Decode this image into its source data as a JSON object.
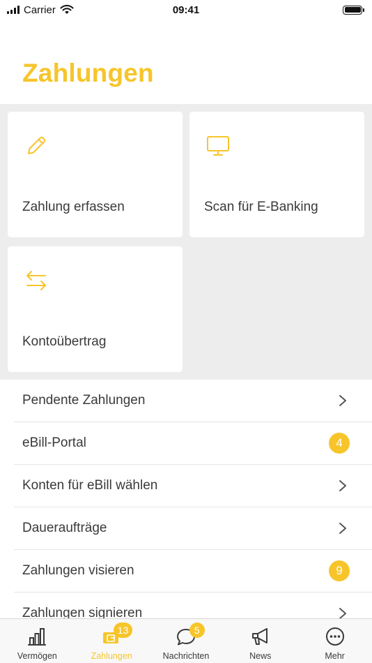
{
  "status_bar": {
    "carrier": "Carrier",
    "time": "09:41"
  },
  "page": {
    "title": "Zahlungen"
  },
  "tiles": [
    {
      "label": "Zahlung erfassen",
      "icon": "pencil-icon"
    },
    {
      "label": "Scan für E-Banking",
      "icon": "monitor-icon"
    },
    {
      "label": "Kontoübertrag",
      "icon": "transfer-arrows-icon"
    }
  ],
  "list": [
    {
      "label": "Pendente Zahlungen"
    },
    {
      "label": "eBill-Portal",
      "badge": "4"
    },
    {
      "label": "Konten für eBill wählen"
    },
    {
      "label": "Daueraufträge"
    },
    {
      "label": "Zahlungen visieren",
      "badge": "9"
    },
    {
      "label": "Zahlungen signieren"
    }
  ],
  "tab_bar": {
    "tabs": [
      {
        "label": "Vermögen",
        "icon": "bar-chart-icon"
      },
      {
        "label": "Zahlungen",
        "icon": "payment-icon",
        "badge": "13",
        "active": true
      },
      {
        "label": "Nachrichten",
        "icon": "chat-bubble-icon",
        "badge": "5"
      },
      {
        "label": "News",
        "icon": "megaphone-icon"
      },
      {
        "label": "Mehr",
        "icon": "more-dots-icon"
      }
    ]
  },
  "colors": {
    "accent": "#f7c52a",
    "text": "#3a3a3a",
    "tiles_background": "#ededed"
  }
}
